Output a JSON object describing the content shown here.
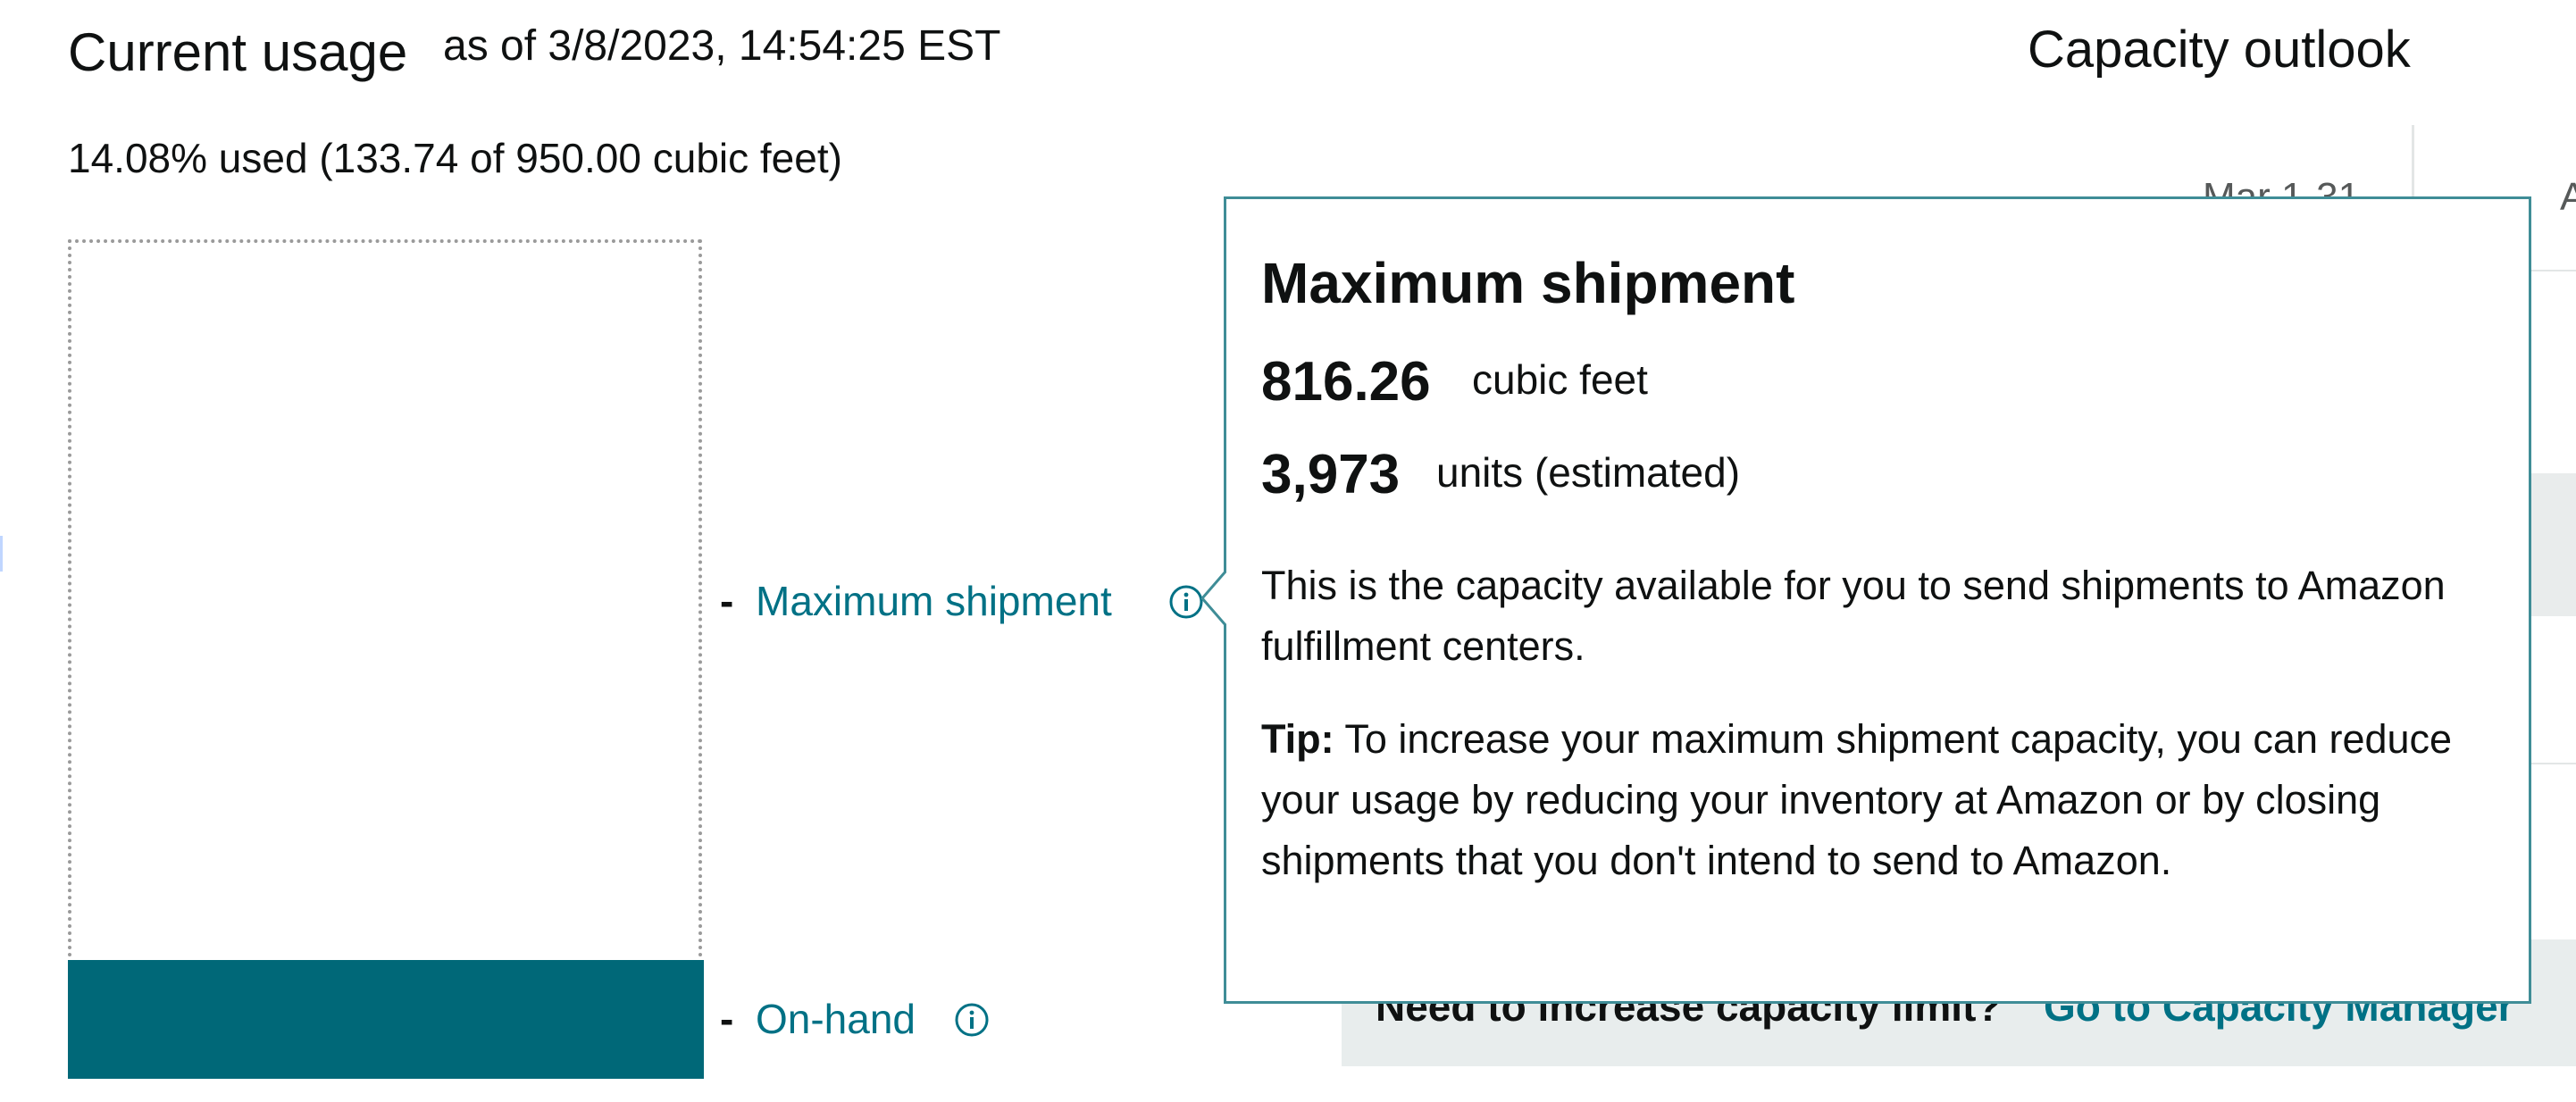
{
  "header": {
    "title": "Current usage",
    "as_of": "as of 3/8/2023, 14:54:25 EST",
    "usage_summary": "14.08% used (133.74 of 950.00 cubic feet)"
  },
  "outlook": {
    "title": "Capacity outlook",
    "month_partial": "Mar 1-31",
    "next_partial": "A"
  },
  "bar": {
    "used_fraction": 0.1408,
    "fill_color": "#006878"
  },
  "legend": {
    "maximum_shipment_label": "Maximum shipment",
    "on_hand_label": "On-hand",
    "dash": "-",
    "icon": "info-icon"
  },
  "popover": {
    "title": "Maximum shipment",
    "cubic_feet_value": "816.26",
    "cubic_feet_unit": "cubic feet",
    "units_value": "3,973",
    "units_unit": "units (estimated)",
    "description": "This is the capacity available for you to send shipments to Amazon fulfillment centers.",
    "tip_label": "Tip:",
    "tip_text": "To increase your maximum shipment capacity, you can reduce your usage by reducing your inventory at Amazon or by closing shipments that you don't intend to send to Amazon."
  },
  "banner": {
    "text": "Need to increase capacity limit?",
    "link": "Go to Capacity Manager"
  },
  "colors": {
    "link": "#007185",
    "popover_border": "#3f8d97",
    "banner_bg": "#e8eded"
  }
}
